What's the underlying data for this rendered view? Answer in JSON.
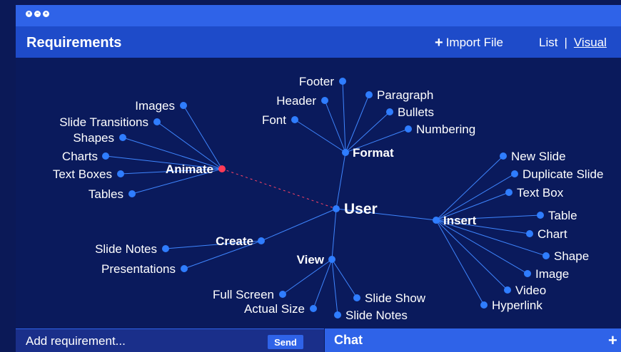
{
  "header": {
    "title": "Requirements",
    "import_label": "Import File",
    "view_list": "List",
    "view_separator": "|",
    "view_visual": "Visual"
  },
  "colors": {
    "node": "#2f7dff",
    "selected_node": "#ff3b57",
    "edge": "#3f86ff",
    "dashed_edge": "#ff4466"
  },
  "mindmap": {
    "root": "User",
    "hubs": {
      "animate": "Animate",
      "format": "Format",
      "insert": "Insert",
      "create": "Create",
      "view": "View"
    },
    "animate_items": [
      "Images",
      "Slide Transitions",
      "Shapes",
      "Charts",
      "Text Boxes",
      "Tables"
    ],
    "format_items": [
      "Footer",
      "Header",
      "Font",
      "Paragraph",
      "Bullets",
      "Numbering"
    ],
    "insert_items": [
      "New Slide",
      "Duplicate Slide",
      "Text Box",
      "Table",
      "Chart",
      "Shape",
      "Image",
      "Video",
      "Hyperlink"
    ],
    "create_items": [
      "Slide Notes",
      "Presentations"
    ],
    "view_items": [
      "Full Screen",
      "Actual Size",
      "Slide Show",
      "Slide Notes"
    ]
  },
  "footer": {
    "input_placeholder": "Add requirement...",
    "send_label": "Send",
    "chat_label": "Chat"
  }
}
